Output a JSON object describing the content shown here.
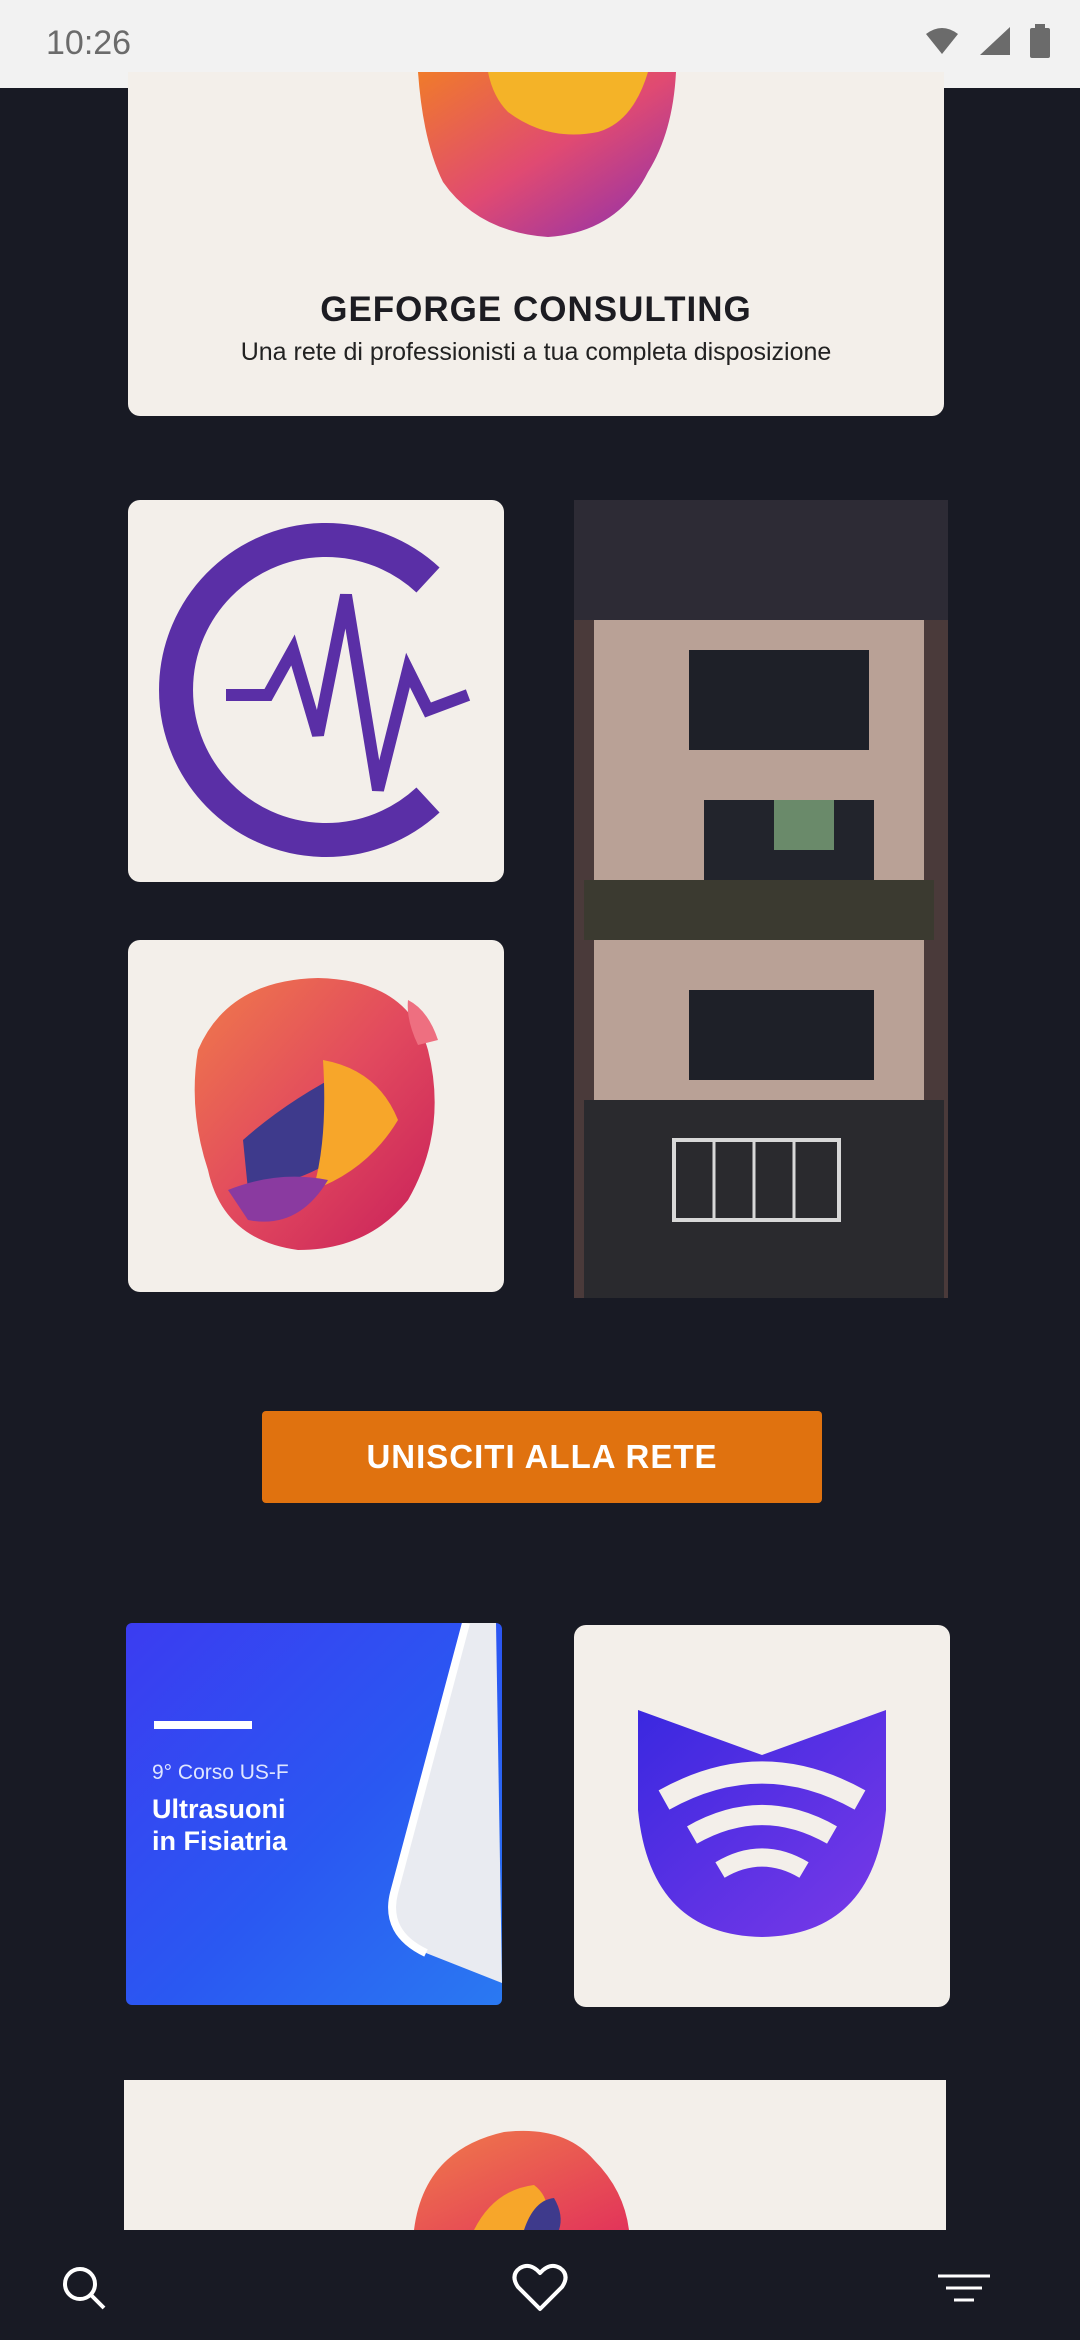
{
  "status_bar": {
    "time": "10:26",
    "icons": [
      "wifi-icon",
      "signal-icon",
      "battery-icon"
    ]
  },
  "hero": {
    "title": "GEFORGE CONSULTING",
    "subtitle": "Una rete di professionisti a tua completa disposizione"
  },
  "cta": {
    "label": "UNISCITI ALLA RETE",
    "color": "#e0720f"
  },
  "course_card": {
    "kicker": "9° Corso US-F",
    "title_line1": "Ultrasuoni",
    "title_line2": "in Fisiatria"
  },
  "bottom_nav": {
    "items": [
      "search-icon",
      "heart-icon",
      "menu-icon"
    ]
  },
  "colors": {
    "background": "#181a24",
    "accent": "#e0720f",
    "brand_purple": "#5a2fa6"
  }
}
